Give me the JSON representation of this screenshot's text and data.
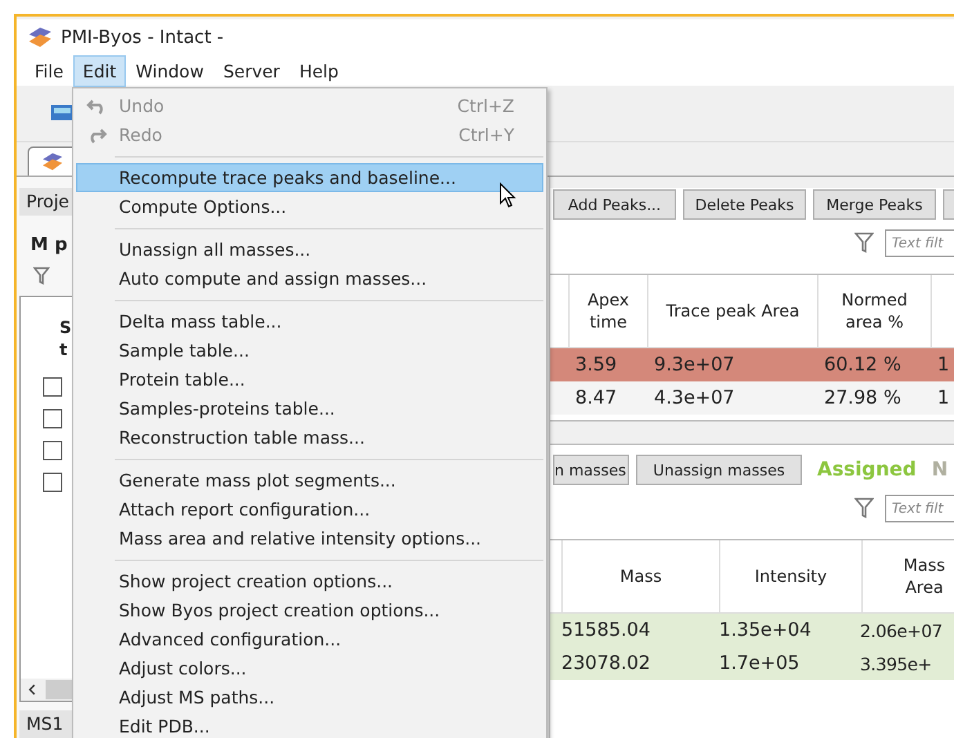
{
  "window": {
    "title": "PMI-Byos - Intact -"
  },
  "menu_bar": [
    {
      "label": "File",
      "selected": false
    },
    {
      "label": "Edit",
      "selected": true
    },
    {
      "label": "Window",
      "selected": false
    },
    {
      "label": "Server",
      "selected": false
    },
    {
      "label": "Help",
      "selected": false
    }
  ],
  "edit_menu": {
    "items": [
      {
        "kind": "undo",
        "label": "Undo",
        "shortcut": "Ctrl+Z",
        "disabled": true,
        "selected": false
      },
      {
        "kind": "redo",
        "label": "Redo",
        "shortcut": "Ctrl+Y",
        "disabled": true,
        "selected": false
      },
      {
        "kind": "separator"
      },
      {
        "kind": "item",
        "label": "Recompute trace peaks and baseline...",
        "disabled": false,
        "selected": true
      },
      {
        "kind": "item",
        "label": "Compute Options...",
        "disabled": false,
        "selected": false
      },
      {
        "kind": "separator"
      },
      {
        "kind": "item",
        "label": "Unassign all masses...",
        "disabled": false,
        "selected": false
      },
      {
        "kind": "item",
        "label": "Auto compute and assign masses...",
        "disabled": false,
        "selected": false
      },
      {
        "kind": "separator"
      },
      {
        "kind": "item",
        "label": "Delta mass table...",
        "disabled": false,
        "selected": false
      },
      {
        "kind": "item",
        "label": "Sample table...",
        "disabled": false,
        "selected": false
      },
      {
        "kind": "item",
        "label": "Protein table...",
        "disabled": false,
        "selected": false
      },
      {
        "kind": "item",
        "label": "Samples-proteins table...",
        "disabled": false,
        "selected": false
      },
      {
        "kind": "item",
        "label": "Reconstruction table mass...",
        "disabled": false,
        "selected": false
      },
      {
        "kind": "separator"
      },
      {
        "kind": "item",
        "label": "Generate mass plot segments...",
        "disabled": false,
        "selected": false
      },
      {
        "kind": "item",
        "label": "Attach report configuration...",
        "disabled": false,
        "selected": false
      },
      {
        "kind": "item",
        "label": "Mass area and relative intensity options...",
        "disabled": false,
        "selected": false
      },
      {
        "kind": "separator"
      },
      {
        "kind": "item",
        "label": "Show project creation options...",
        "disabled": false,
        "selected": false
      },
      {
        "kind": "item",
        "label": "Show Byos project creation options...",
        "disabled": false,
        "selected": false
      },
      {
        "kind": "item",
        "label": "Advanced configuration...",
        "disabled": false,
        "selected": false
      },
      {
        "kind": "item",
        "label": "Adjust colors...",
        "disabled": false,
        "selected": false
      },
      {
        "kind": "item",
        "label": "Adjust MS paths...",
        "disabled": false,
        "selected": false
      },
      {
        "kind": "item",
        "label": "Edit PDB...",
        "disabled": false,
        "selected": false
      }
    ]
  },
  "left_panel": {
    "tab": "Proje",
    "heading": "M p",
    "tree_lines": [
      "S",
      "t"
    ],
    "checkboxes": [
      {
        "checked": false
      },
      {
        "checked": false
      },
      {
        "checked": false
      },
      {
        "checked": false
      }
    ],
    "bottom_tab": "MS1"
  },
  "peaks": {
    "buttons": [
      "Add Peaks...",
      "Delete Peaks",
      "Merge Peaks"
    ],
    "filter_placeholder": "Text filt",
    "columns": [
      "",
      "Apex time",
      "Trace peak Area",
      "Normed area %",
      ""
    ],
    "rows": [
      {
        "color": "#d4887a",
        "cells": [
          "",
          "3.59",
          "9.3e+07",
          "60.12 %",
          "1"
        ]
      },
      {
        "color": "#f4f4f4",
        "cells": [
          "",
          "8.47",
          "4.3e+07",
          "27.98 %",
          "1"
        ]
      }
    ]
  },
  "masses": {
    "buttons": [
      "n masses",
      "Unassign masses"
    ],
    "status": [
      {
        "label": "Assigned",
        "color": "#8cc63f"
      },
      {
        "label": "N",
        "color": "#b0b0a0"
      }
    ],
    "filter_placeholder": "Text filt",
    "columns": [
      "",
      "Mass",
      "Intensity",
      "Mass Area"
    ],
    "rows": [
      {
        "color": "#e2edd5",
        "cells": [
          "",
          "51585.04",
          "1.35e+04",
          "2.06e+07"
        ]
      },
      {
        "color": "#e2edd5",
        "cells": [
          "",
          "23078.02",
          "1.7e+05",
          "3.395e+"
        ]
      }
    ]
  }
}
